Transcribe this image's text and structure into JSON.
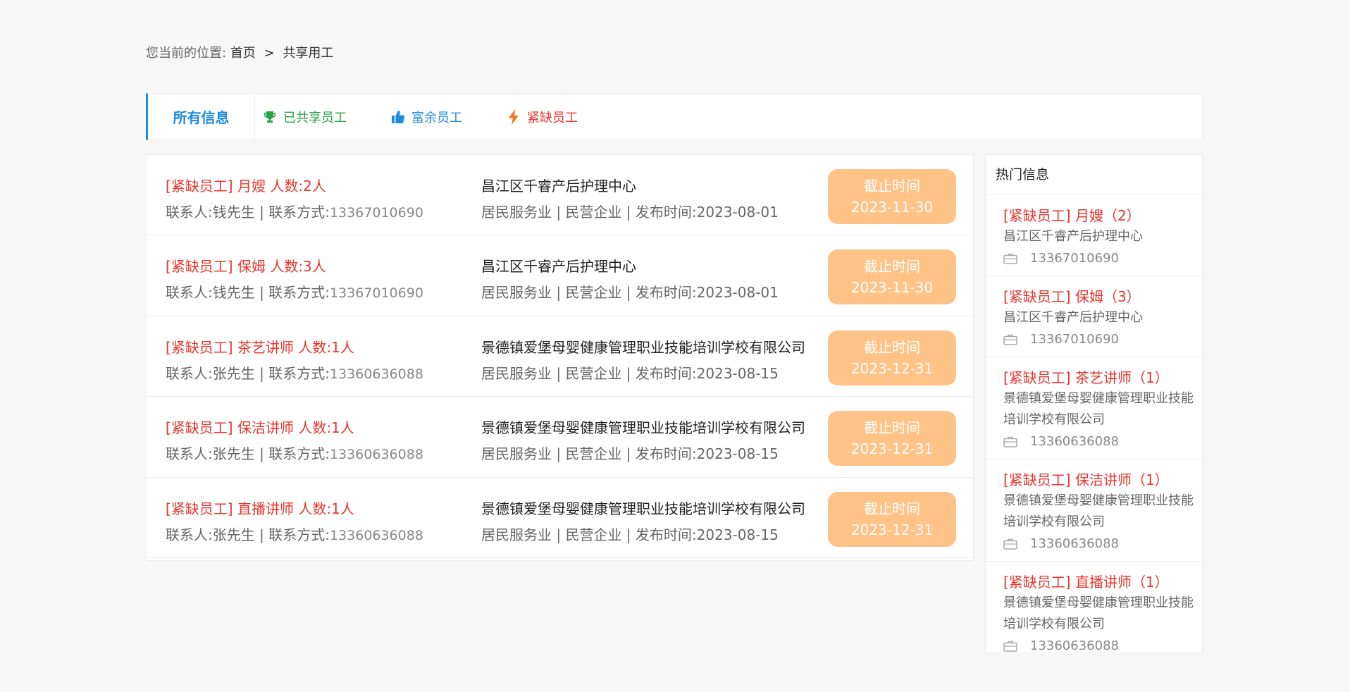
{
  "breadcrumb": {
    "prefix": "您当前的位置:",
    "home": "首页",
    "separator": ">",
    "current": "共享用工"
  },
  "tabs": {
    "all": "所有信息",
    "shared": "已共享员工",
    "surplus": "富余员工",
    "urgent": "紧缺员工",
    "colors": {
      "active": "#1e8be0",
      "shared": "#2aa045",
      "surplus": "#1e8be0",
      "urgent": "#e8352d"
    },
    "icons": {
      "shared": "trophy-icon",
      "surplus": "thumbs-up-icon",
      "urgent": "lightning-icon"
    }
  },
  "list": [
    {
      "title": "[紧缺员工] 月嫂 人数:2人",
      "contact_label": "联系人:钱先生 | 联系方式:",
      "phone": "13367010690",
      "company": "昌江区千睿产后护理中心",
      "meta": "居民服务业 | 民营企业 | 发布时间:2023-08-01",
      "deadline_label": "截止时间",
      "deadline": "2023-11-30"
    },
    {
      "title": "[紧缺员工] 保姆 人数:3人",
      "contact_label": "联系人:钱先生 | 联系方式:",
      "phone": "13367010690",
      "company": "昌江区千睿产后护理中心",
      "meta": "居民服务业 | 民营企业 | 发布时间:2023-08-01",
      "deadline_label": "截止时间",
      "deadline": "2023-11-30"
    },
    {
      "title": "[紧缺员工] 茶艺讲师 人数:1人",
      "contact_label": "联系人:张先生 | 联系方式:",
      "phone": "13360636088",
      "company": "景德镇爱堡母婴健康管理职业技能培训学校有限公司",
      "meta": "居民服务业 | 民营企业 | 发布时间:2023-08-15",
      "deadline_label": "截止时间",
      "deadline": "2023-12-31"
    },
    {
      "title": "[紧缺员工] 保洁讲师 人数:1人",
      "contact_label": "联系人:张先生 | 联系方式:",
      "phone": "13360636088",
      "company": "景德镇爱堡母婴健康管理职业技能培训学校有限公司",
      "meta": "居民服务业 | 民营企业 | 发布时间:2023-08-15",
      "deadline_label": "截止时间",
      "deadline": "2023-12-31"
    },
    {
      "title": "[紧缺员工] 直播讲师 人数:1人",
      "contact_label": "联系人:张先生 | 联系方式:",
      "phone": "13360636088",
      "company": "景德镇爱堡母婴健康管理职业技能培训学校有限公司",
      "meta": "居民服务业 | 民营企业 | 发布时间:2023-08-15",
      "deadline_label": "截止时间",
      "deadline": "2023-12-31"
    }
  ],
  "hot": {
    "heading": "热门信息",
    "items": [
      {
        "title": "[紧缺员工] 月嫂（2）",
        "company": "昌江区千睿产后护理中心",
        "phone": "13367010690"
      },
      {
        "title": "[紧缺员工] 保姆（3）",
        "company": "昌江区千睿产后护理中心",
        "phone": "13367010690"
      },
      {
        "title": "[紧缺员工] 茶艺讲师（1）",
        "company": "景德镇爱堡母婴健康管理职业技能培训学校有限公司",
        "phone": "13360636088"
      },
      {
        "title": "[紧缺员工] 保洁讲师（1）",
        "company": "景德镇爱堡母婴健康管理职业技能培训学校有限公司",
        "phone": "13360636088"
      },
      {
        "title": "[紧缺员工] 直播讲师（1）",
        "company": "景德镇爱堡母婴健康管理职业技能培训学校有限公司",
        "phone": "13360636088"
      }
    ]
  }
}
